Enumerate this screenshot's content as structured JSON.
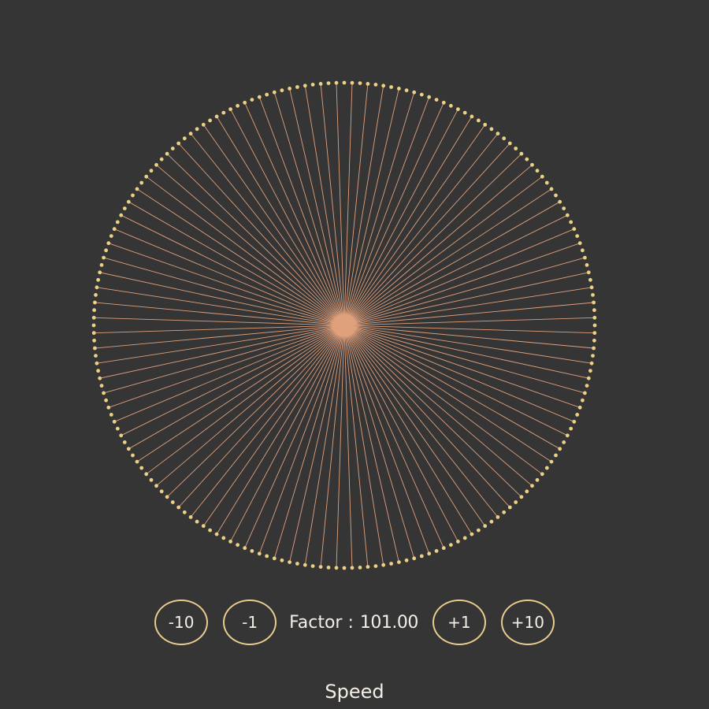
{
  "controls": {
    "buttons": [
      "-10",
      "-1",
      "+1",
      "+10"
    ],
    "factor_label": "Factor :",
    "factor_value": "101.00"
  },
  "speed_label": "Speed",
  "visual": {
    "factor": 101,
    "points": 200,
    "colors": {
      "background": "#353535",
      "ring_dot": "#ecd085",
      "line": "#e9a681",
      "button_border": "#e9cd8f",
      "text": "#f3efe6"
    }
  }
}
